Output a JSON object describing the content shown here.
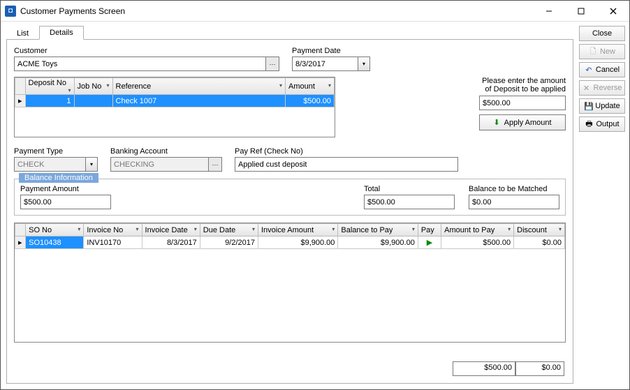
{
  "window": {
    "title": "Customer Payments Screen"
  },
  "side": {
    "close": "Close",
    "new": "New",
    "cancel": "Cancel",
    "reverse": "Reverse",
    "update": "Update",
    "output": "Output"
  },
  "tabs": {
    "list": "List",
    "details": "Details"
  },
  "customer": {
    "label": "Customer",
    "value": "ACME Toys"
  },
  "paymentDate": {
    "label": "Payment Date",
    "value": "8/3/2017"
  },
  "depositGrid": {
    "headers": {
      "depositNo": "Deposit No",
      "jobNo": "Job No",
      "reference": "Reference",
      "amount": "Amount"
    },
    "row": {
      "depositNo": "1",
      "jobNo": "",
      "reference": "Check 1007",
      "amount": "$500.00"
    }
  },
  "depositPrompt": {
    "line1": "Please enter the amount",
    "line2": "of Deposit to be applied",
    "value": "$500.00",
    "apply": "Apply Amount"
  },
  "paymentType": {
    "label": "Payment Type",
    "value": "CHECK"
  },
  "bankingAccount": {
    "label": "Banking Account",
    "value": "CHECKING"
  },
  "payRef": {
    "label": "Pay Ref (Check No)",
    "value": "Applied cust deposit"
  },
  "balance": {
    "legend": "Balance Information",
    "paymentAmount": {
      "label": "Payment Amount",
      "value": "$500.00"
    },
    "total": {
      "label": "Total",
      "value": "$500.00"
    },
    "toMatch": {
      "label": "Balance to be Matched",
      "value": "$0.00"
    }
  },
  "invoiceGrid": {
    "headers": {
      "soNo": "SO No",
      "invoiceNo": "Invoice No",
      "invoiceDate": "Invoice Date",
      "dueDate": "Due Date",
      "invoiceAmount": "Invoice Amount",
      "balanceToPay": "Balance to Pay",
      "pay": "Pay",
      "amountToPay": "Amount to Pay",
      "discount": "Discount"
    },
    "row": {
      "soNo": "SO10438",
      "invoiceNo": "INV10170",
      "invoiceDate": "8/3/2017",
      "dueDate": "9/2/2017",
      "invoiceAmount": "$9,900.00",
      "balanceToPay": "$9,900.00",
      "amountToPay": "$500.00",
      "discount": "$0.00"
    }
  },
  "footer": {
    "amountToPay": "$500.00",
    "discount": "$0.00"
  }
}
